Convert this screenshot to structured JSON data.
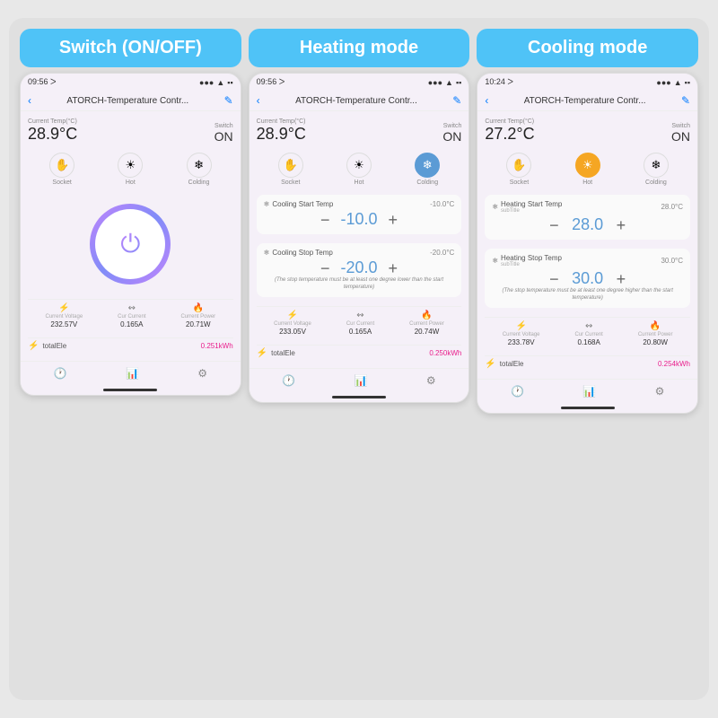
{
  "sections": [
    {
      "id": "switch",
      "mode_label": "Switch (ON/OFF)",
      "status_bar": {
        "time": "09:56",
        "signal": "●●●",
        "wifi": "▲",
        "battery": "▪"
      },
      "nav_title": "ATORCH-Temperature Contr...",
      "current_temp_label": "Current Temp(°C)",
      "current_temp": "28.9°C",
      "switch_label": "Switch",
      "switch_value": "ON",
      "icons": [
        {
          "symbol": "✋",
          "label": "Socket",
          "active": false
        },
        {
          "symbol": "☀",
          "label": "Hot",
          "active": false
        },
        {
          "symbol": "❄",
          "label": "Colding",
          "active": false
        }
      ],
      "show_power": true,
      "stats": [
        {
          "icon": "⚡",
          "label": "Current Voltage",
          "value": "232.57V"
        },
        {
          "icon": "↭",
          "label": "Cur Current",
          "value": "0.165A"
        },
        {
          "icon": "🔥",
          "label": "Current Power",
          "value": "20.71W"
        }
      ],
      "total_label": "totalEle",
      "total_value": "0.251kWh"
    },
    {
      "id": "heating",
      "mode_label": "Heating mode",
      "status_bar": {
        "time": "09:56",
        "signal": "●●●",
        "wifi": "▲",
        "battery": "▪"
      },
      "nav_title": "ATORCH-Temperature Contr...",
      "current_temp_label": "Current Temp(°C)",
      "current_temp": "28.9°C",
      "switch_label": "Switch",
      "switch_value": "ON",
      "icons": [
        {
          "symbol": "✋",
          "label": "Socket",
          "active": false
        },
        {
          "symbol": "☀",
          "label": "Hot",
          "active": false
        },
        {
          "symbol": "❄",
          "label": "Colding",
          "active": true,
          "type": "blue"
        }
      ],
      "show_power": false,
      "settings": [
        {
          "title": "Cooling Start Temp",
          "subtitle": "",
          "current": "-10.0°C",
          "value": "-10.0",
          "warning": ""
        },
        {
          "title": "Cooling Stop Temp",
          "subtitle": "",
          "current": "-20.0°C",
          "value": "-20.0",
          "warning": "(The stop temperature must be at least one degree lower than the start temperature)"
        }
      ],
      "stats": [
        {
          "icon": "⚡",
          "label": "Current Voltage",
          "value": "233.05V"
        },
        {
          "icon": "↭",
          "label": "Cur Current",
          "value": "0.165A"
        },
        {
          "icon": "🔥",
          "label": "Current Power",
          "value": "20.74W"
        }
      ],
      "total_label": "totalEle",
      "total_value": "0.250kWh"
    },
    {
      "id": "cooling",
      "mode_label": "Cooling mode",
      "status_bar": {
        "time": "10:24",
        "signal": "●●●",
        "wifi": "▲",
        "battery": "▪"
      },
      "nav_title": "ATORCH-Temperature Contr...",
      "current_temp_label": "Current Temp(°C)",
      "current_temp": "27.2°C",
      "switch_label": "Switch",
      "switch_value": "ON",
      "icons": [
        {
          "symbol": "✋",
          "label": "Socket",
          "active": false
        },
        {
          "symbol": "☀",
          "label": "Hot",
          "active": true,
          "type": "yellow"
        },
        {
          "symbol": "❄",
          "label": "Colding",
          "active": false
        }
      ],
      "show_power": false,
      "settings": [
        {
          "title": "Heating Start Temp",
          "subtitle": "subTitle",
          "current": "28.0°C",
          "value": "28.0",
          "warning": ""
        },
        {
          "title": "Heating Stop Temp",
          "subtitle": "subTitle",
          "current": "30.0°C",
          "value": "30.0",
          "warning": "(The stop temperature must be at least one degree higher than the start temperature)"
        }
      ],
      "stats": [
        {
          "icon": "⚡",
          "label": "Current Voltage",
          "value": "233.78V"
        },
        {
          "icon": "↭",
          "label": "Cur Current",
          "value": "0.168A"
        },
        {
          "icon": "🔥",
          "label": "Current Power",
          "value": "20.80W"
        }
      ],
      "total_label": "totalEle",
      "total_value": "0.254kWh"
    }
  ]
}
